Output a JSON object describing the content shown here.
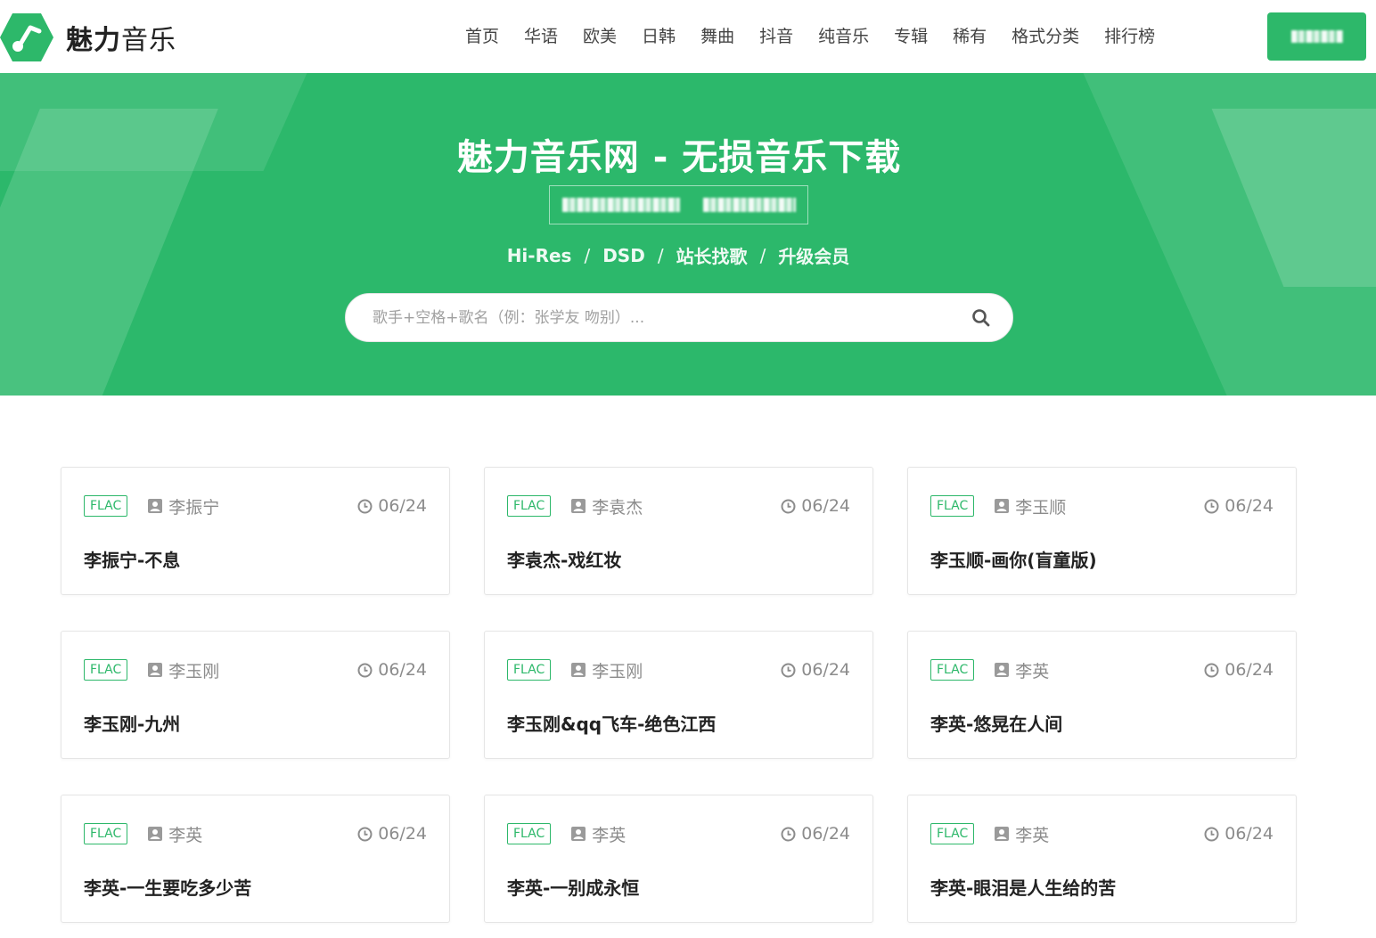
{
  "brand": {
    "name_bold": "魅力",
    "name_regular": "音乐",
    "logo_icon": "music-note-hexagon-icon",
    "color": "#2db86a"
  },
  "nav": [
    {
      "label": "首页"
    },
    {
      "label": "华语"
    },
    {
      "label": "欧美"
    },
    {
      "label": "日韩"
    },
    {
      "label": "舞曲"
    },
    {
      "label": "抖音"
    },
    {
      "label": "纯音乐"
    },
    {
      "label": "专辑"
    },
    {
      "label": "稀有"
    },
    {
      "label": "格式分类"
    },
    {
      "label": "排行榜"
    }
  ],
  "hero": {
    "title": "魅力音乐网 - 无损音乐下载",
    "links": [
      {
        "label": "Hi-Res"
      },
      {
        "label": "DSD"
      },
      {
        "label": "站长找歌"
      },
      {
        "label": "升级会员"
      }
    ],
    "separator": "/",
    "background_color": "#2cb86b"
  },
  "search": {
    "placeholder": "歌手+空格+歌名（例：张学友 吻别）...",
    "value": "",
    "icon": "search-icon"
  },
  "cards": [
    {
      "format": "FLAC",
      "artist": "李振宁",
      "date": "06/24",
      "title": "李振宁-不息"
    },
    {
      "format": "FLAC",
      "artist": "李袁杰",
      "date": "06/24",
      "title": "李袁杰-戏红妆"
    },
    {
      "format": "FLAC",
      "artist": "李玉顺",
      "date": "06/24",
      "title": "李玉顺-画你(盲童版)"
    },
    {
      "format": "FLAC",
      "artist": "李玉刚",
      "date": "06/24",
      "title": "李玉刚-九州"
    },
    {
      "format": "FLAC",
      "artist": "李玉刚",
      "date": "06/24",
      "title": "李玉刚&qq飞车-绝色江西"
    },
    {
      "format": "FLAC",
      "artist": "李英",
      "date": "06/24",
      "title": "李英-悠晃在人间"
    },
    {
      "format": "FLAC",
      "artist": "李英",
      "date": "06/24",
      "title": "李英-一生要吃多少苦"
    },
    {
      "format": "FLAC",
      "artist": "李英",
      "date": "06/24",
      "title": "李英-一别成永恒"
    },
    {
      "format": "FLAC",
      "artist": "李英",
      "date": "06/24",
      "title": "李英-眼泪是人生给的苦"
    }
  ]
}
